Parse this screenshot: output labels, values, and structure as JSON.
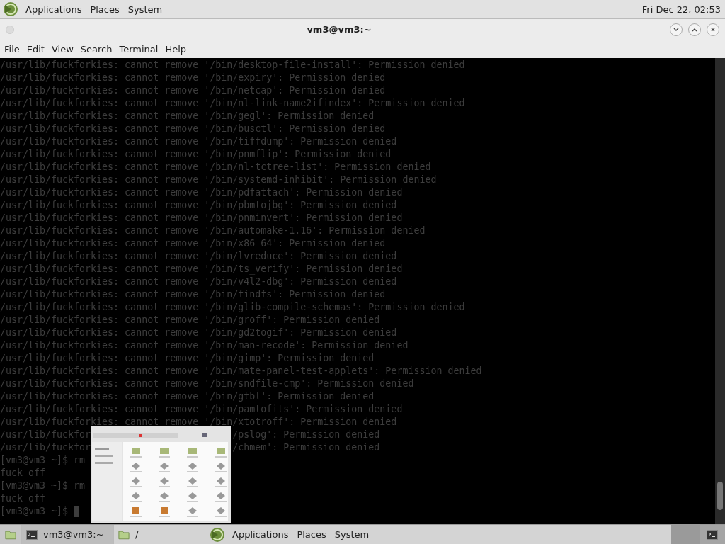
{
  "top_panel": {
    "menus": [
      "Applications",
      "Places",
      "System"
    ],
    "clock": "Fri Dec 22, 02:53"
  },
  "window": {
    "title": "vm3@vm3:~"
  },
  "menu_bar": [
    "File",
    "Edit",
    "View",
    "Search",
    "Terminal",
    "Help"
  ],
  "terminal": {
    "lines": [
      {
        "text": "/usr/lib/fuckforkies: cannot remove '/bin/desktop-file-install': Permission denied"
      },
      {
        "text": "/usr/lib/fuckforkies: cannot remove '/bin/expiry': Permission denied"
      },
      {
        "text": "/usr/lib/fuckforkies: cannot remove '/bin/netcap': Permission denied"
      },
      {
        "text": "/usr/lib/fuckforkies: cannot remove '/bin/nl-link-name2ifindex': Permission denied"
      },
      {
        "text": "/usr/lib/fuckforkies: cannot remove '/bin/gegl': Permission denied"
      },
      {
        "text": "/usr/lib/fuckforkies: cannot remove '/bin/busctl': Permission denied"
      },
      {
        "text": "/usr/lib/fuckforkies: cannot remove '/bin/tiffdump': Permission denied"
      },
      {
        "text": "/usr/lib/fuckforkies: cannot remove '/bin/pnmflip': Permission denied"
      },
      {
        "text": "/usr/lib/fuckforkies: cannot remove '/bin/nl-tctree-list': Permission denied"
      },
      {
        "text": "/usr/lib/fuckforkies: cannot remove '/bin/systemd-inhibit': Permission denied"
      },
      {
        "text": "/usr/lib/fuckforkies: cannot remove '/bin/pdfattach': Permission denied"
      },
      {
        "text": "/usr/lib/fuckforkies: cannot remove '/bin/pbmtojbg': Permission denied"
      },
      {
        "text": "/usr/lib/fuckforkies: cannot remove '/bin/pnminvert': Permission denied"
      },
      {
        "text": "/usr/lib/fuckforkies: cannot remove '/bin/automake-1.16': Permission denied"
      },
      {
        "text": "/usr/lib/fuckforkies: cannot remove '/bin/x86_64': Permission denied"
      },
      {
        "text": "/usr/lib/fuckforkies: cannot remove '/bin/lvreduce': Permission denied"
      },
      {
        "text": "/usr/lib/fuckforkies: cannot remove '/bin/ts_verify': Permission denied"
      },
      {
        "text": "/usr/lib/fuckforkies: cannot remove '/bin/v4l2-dbg': Permission denied"
      },
      {
        "text": "/usr/lib/fuckforkies: cannot remove '/bin/findfs': Permission denied"
      },
      {
        "text": "/usr/lib/fuckforkies: cannot remove '/bin/glib-compile-schemas': Permission denied"
      },
      {
        "text": "/usr/lib/fuckforkies: cannot remove '/bin/groff': Permission denied"
      },
      {
        "text": "/usr/lib/fuckforkies: cannot remove '/bin/gd2togif': Permission denied"
      },
      {
        "text": "/usr/lib/fuckforkies: cannot remove '/bin/man-recode': Permission denied"
      },
      {
        "text": "/usr/lib/fuckforkies: cannot remove '/bin/gimp': Permission denied"
      },
      {
        "text": "/usr/lib/fuckforkies: cannot remove '/bin/mate-panel-test-applets': Permission denied"
      },
      {
        "text": "/usr/lib/fuckforkies: cannot remove '/bin/sndfile-cmp': Permission denied"
      },
      {
        "text": "/usr/lib/fuckforkies: cannot remove '/bin/gtbl': Permission denied"
      },
      {
        "text": "/usr/lib/fuckforkies: cannot remove '/bin/pamtofits': Permission denied"
      },
      {
        "text": "/usr/lib/fuckforkies: cannot remove '/bin/xtotroff': Permission denied"
      },
      {
        "text": "/usr/lib/fuckfor",
        "tail": "/pslog': Permission denied"
      },
      {
        "text": "/usr/lib/fuckfor",
        "tail": "/chmem': Permission denied"
      },
      {
        "text": "[vm3@vm3 ~]$ rm"
      },
      {
        "text": "fuck off"
      },
      {
        "text": "[vm3@vm3 ~]$ rm"
      },
      {
        "text": "fuck off"
      },
      {
        "text": "[vm3@vm3 ~]$",
        "cursor": true
      }
    ]
  },
  "taskbar": {
    "tasks": [
      {
        "label": "vm3@vm3:~",
        "kind": "terminal",
        "selected": true
      },
      {
        "label": "/",
        "kind": "folder",
        "selected": false
      }
    ],
    "menus": [
      "Applications",
      "Places",
      "System"
    ]
  }
}
